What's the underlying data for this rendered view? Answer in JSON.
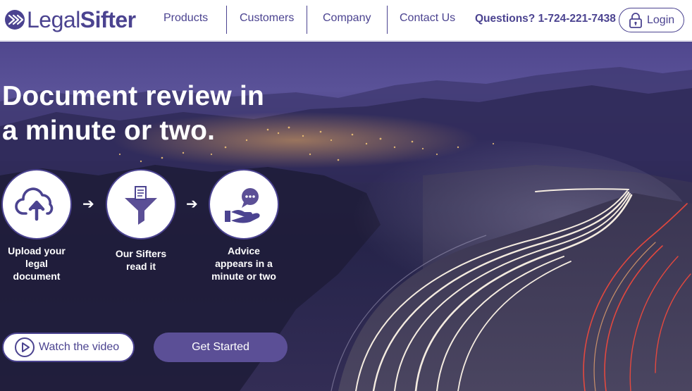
{
  "brand": {
    "name_light": "Legal",
    "name_bold": "Sifter"
  },
  "nav": {
    "items": [
      {
        "label": "Products"
      },
      {
        "label": "Customers"
      },
      {
        "label": "Company"
      },
      {
        "label": "Contact Us"
      }
    ],
    "phone": "Questions? 1-724-221-7438",
    "login_label": "Login"
  },
  "hero": {
    "headline_line1": "Document review in",
    "headline_line2": "a minute or two.",
    "steps": [
      {
        "icon": "cloud-upload-icon",
        "label_lines": [
          "Upload your",
          "legal",
          "document"
        ]
      },
      {
        "icon": "funnel-document-icon",
        "label_lines": [
          "Our Sifters",
          "read it"
        ]
      },
      {
        "icon": "hand-speech-bubble-icon",
        "label_lines": [
          "Advice",
          "appears in a",
          "minute or two"
        ]
      }
    ],
    "arrow_glyph": "➔",
    "watch_video_label": "Watch the video",
    "get_started_label": "Get Started"
  },
  "colors": {
    "brand_purple": "#4b4390",
    "button_purple": "#5b4f96",
    "white": "#ffffff"
  }
}
